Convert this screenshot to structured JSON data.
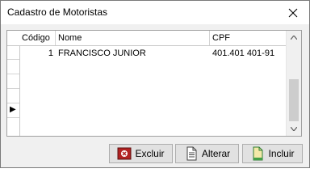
{
  "window": {
    "title": "Cadastro de Motoristas"
  },
  "grid": {
    "columns": [
      "Código",
      "Nome",
      "CPF"
    ],
    "rows": [
      {
        "codigo": "1",
        "nome": "FRANCISCO JUNIOR",
        "cpf": "401.401 401-91"
      }
    ],
    "current_row_marker": "▶"
  },
  "buttons": {
    "excluir": "Excluir",
    "alterar": "Alterar",
    "incluir": "Incluir"
  },
  "icons": {
    "close": "close-icon",
    "excluir": "delete-icon",
    "alterar": "document-edit-icon",
    "incluir": "document-new-icon"
  }
}
